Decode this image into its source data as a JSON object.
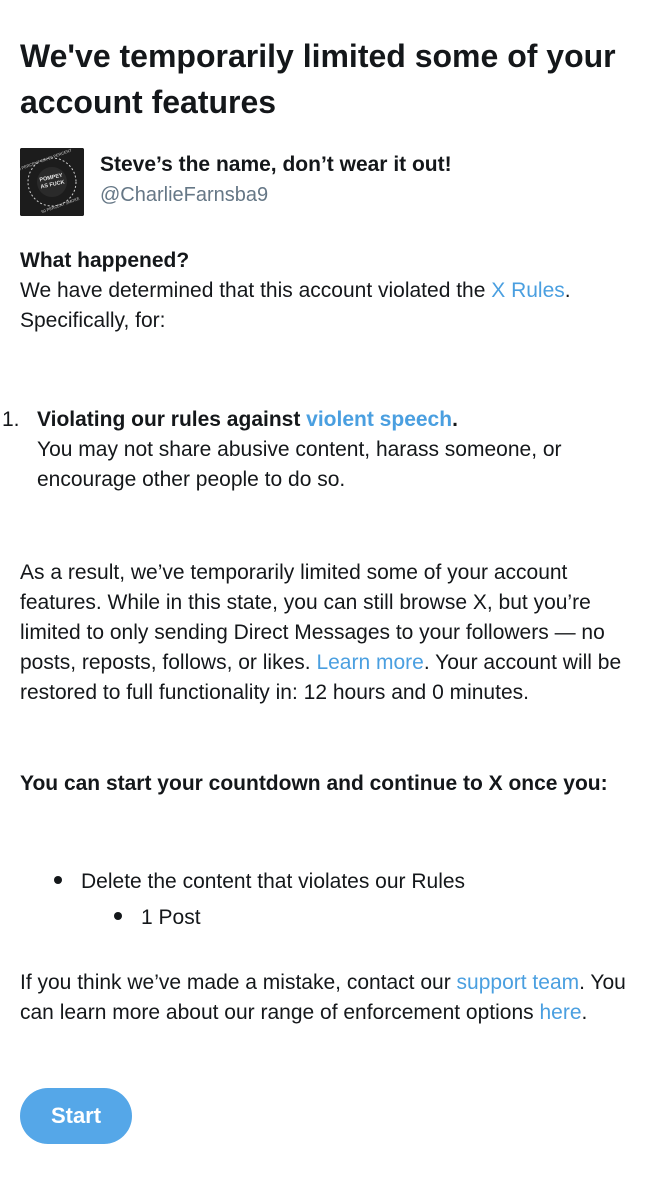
{
  "title": "We've temporarily limited some of your account features",
  "profile": {
    "display_name": "Steve’s the name, don’t wear it out!",
    "handle": "@CharlieFarnsba9",
    "avatar_text_top": "30 PERCENT GIN 20 PERCENT",
    "avatar_text_mid1": "POMPEY",
    "avatar_text_mid2": "AS FUCK",
    "avatar_text_bottom": "50 PERCENT SMOKE"
  },
  "what_happened": {
    "heading": "What happened?",
    "text_before_link": "We have determined that this account violated the ",
    "link": "X Rules",
    "text_after_link": ".",
    "line2": "Specifically, for:"
  },
  "violation": {
    "number": "1.",
    "title_before_link": "Violating our rules against ",
    "title_link": "violent speech",
    "title_after_link": ".",
    "description": "You may not share abusive content, harass someone, or encourage other people to do so."
  },
  "result": {
    "text_before_link": "As a result, we’ve temporarily limited some of your account features. While in this state, you can still browse X, but you’re limited to only sending Direct Messages to your followers — no posts, reposts, follows, or likes. ",
    "link": "Learn more",
    "text_after_link": ". Your account will be restored to full functionality in: 12 hours and 0 minutes."
  },
  "countdown": {
    "heading": "You can start your countdown and continue to X once you:",
    "item": "Delete the content that violates our Rules",
    "subitem": "1 Post"
  },
  "mistake": {
    "text_before_link1": "If you think we’ve made a mistake, contact our ",
    "link1": "support team",
    "text_middle": ". You can learn more about our range of enforcement options ",
    "link2": "here",
    "text_end": "."
  },
  "start_button": "Start",
  "colors": {
    "link": "#4a9fe0",
    "button": "#55a7e8",
    "text": "#14171a",
    "secondary": "#657786"
  }
}
